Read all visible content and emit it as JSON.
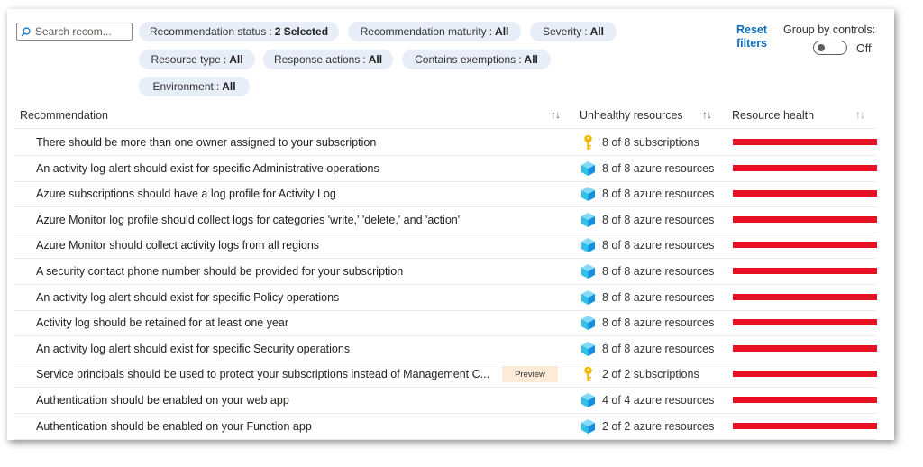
{
  "search": {
    "placeholder": "Search recom..."
  },
  "filters": [
    {
      "label": "Recommendation status",
      "value": "2 Selected"
    },
    {
      "label": "Recommendation maturity",
      "value": "All"
    },
    {
      "label": "Severity",
      "value": "All"
    },
    {
      "label": "Resource type",
      "value": "All"
    },
    {
      "label": "Response actions",
      "value": "All"
    },
    {
      "label": "Contains exemptions",
      "value": "All"
    },
    {
      "label": "Environment",
      "value": "All"
    }
  ],
  "reset_filters": "Reset filters",
  "group_by": {
    "label": "Group by controls:",
    "state": "Off"
  },
  "columns": {
    "recommendation": "Recommendation",
    "unhealthy": "Unhealthy resources",
    "health": "Resource health",
    "sort_glyph": "↑↓"
  },
  "health_color": "#e81123",
  "rows": [
    {
      "name": "There should be more than one owner assigned to your subscription",
      "icon": "key-icon",
      "unhealthy": "8 of 8 subscriptions",
      "health": 1.0
    },
    {
      "name": "An activity log alert should exist for specific Administrative operations",
      "icon": "cube-icon",
      "unhealthy": "8 of 8 azure resources",
      "health": 1.0
    },
    {
      "name": "Azure subscriptions should have a log profile for Activity Log",
      "icon": "cube-icon",
      "unhealthy": "8 of 8 azure resources",
      "health": 1.0
    },
    {
      "name": "Azure Monitor log profile should collect logs for categories 'write,' 'delete,' and 'action'",
      "icon": "cube-icon",
      "unhealthy": "8 of 8 azure resources",
      "health": 1.0
    },
    {
      "name": "Azure Monitor should collect activity logs from all regions",
      "icon": "cube-icon",
      "unhealthy": "8 of 8 azure resources",
      "health": 1.0
    },
    {
      "name": "A security contact phone number should be provided for your subscription",
      "icon": "cube-icon",
      "unhealthy": "8 of 8 azure resources",
      "health": 1.0
    },
    {
      "name": "An activity log alert should exist for specific Policy operations",
      "icon": "cube-icon",
      "unhealthy": "8 of 8 azure resources",
      "health": 1.0
    },
    {
      "name": "Activity log should be retained for at least one year",
      "icon": "cube-icon",
      "unhealthy": "8 of 8 azure resources",
      "health": 1.0
    },
    {
      "name": "An activity log alert should exist for specific Security operations",
      "icon": "cube-icon",
      "unhealthy": "8 of 8 azure resources",
      "health": 1.0
    },
    {
      "name": "Service principals should be used to protect your subscriptions instead of Management C...",
      "badge": "Preview",
      "icon": "key-icon",
      "unhealthy": "2 of 2 subscriptions",
      "health": 1.0
    },
    {
      "name": "Authentication should be enabled on your web app",
      "icon": "cube-icon",
      "unhealthy": "4 of 4 azure resources",
      "health": 1.0
    },
    {
      "name": "Authentication should be enabled on your Function app",
      "icon": "cube-icon",
      "unhealthy": "2 of 2 azure resources",
      "health": 1.0
    }
  ]
}
